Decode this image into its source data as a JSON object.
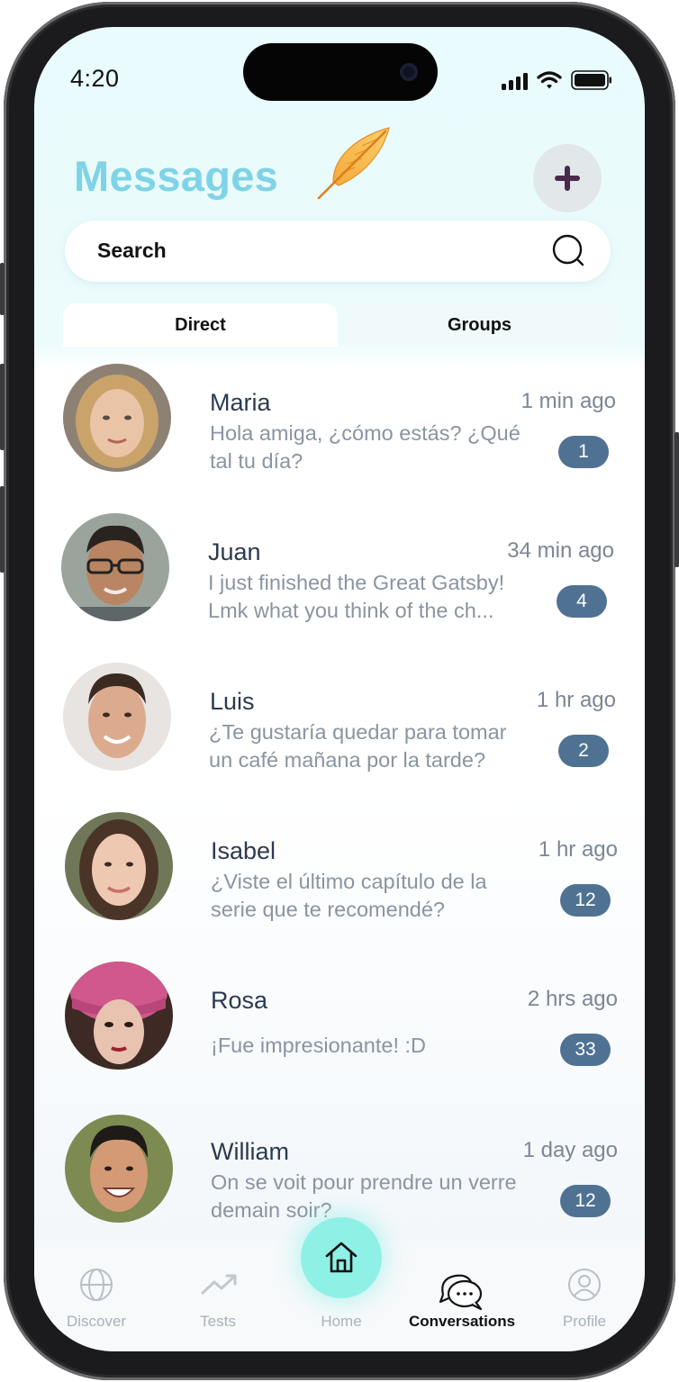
{
  "status_bar": {
    "time": "4:20"
  },
  "header": {
    "title": "Messages",
    "compose_icon": "plus-icon"
  },
  "search": {
    "placeholder": "Search",
    "icon": "search-icon"
  },
  "tabs": [
    {
      "label": "Direct",
      "selected": true
    },
    {
      "label": "Groups",
      "selected": false
    }
  ],
  "conversations": [
    {
      "name": "Maria",
      "time": "1 min ago",
      "message": "Hola amiga, ¿cómo estás? ¿Qué tal tu día?",
      "unread": "1"
    },
    {
      "name": "Juan",
      "time": "34 min ago",
      "message": "I just finished the Great Gatsby! Lmk what you think of the ch...",
      "unread": "4"
    },
    {
      "name": "Luis",
      "time": "1 hr ago",
      "message": "¿Te gustaría quedar para tomar un café mañana por la tarde?",
      "unread": "2"
    },
    {
      "name": "Isabel",
      "time": "1 hr ago",
      "message": "¿Viste el último capítulo de la serie que te recomendé?",
      "unread": "12"
    },
    {
      "name": "Rosa",
      "time": "2 hrs ago",
      "message": "¡Fue impresionante! :D",
      "unread": "33"
    },
    {
      "name": "William",
      "time": "1 day ago",
      "message": "On se voit pour prendre un verre demain soir?",
      "unread": "12"
    }
  ],
  "bottom_nav": [
    {
      "label": "Discover",
      "icon": "globe-icon"
    },
    {
      "label": "Tests",
      "icon": "trend-icon"
    },
    {
      "label": "Home",
      "icon": "home-icon"
    },
    {
      "label": "Conversations",
      "icon": "chat-bubbles-icon",
      "active": true
    },
    {
      "label": "Profile",
      "icon": "user-icon"
    }
  ],
  "colors": {
    "title": "#7fd3e6",
    "badge": "#4f7293",
    "home_fab": "#8ff0e6",
    "compose_plus": "#4a2a4a"
  }
}
